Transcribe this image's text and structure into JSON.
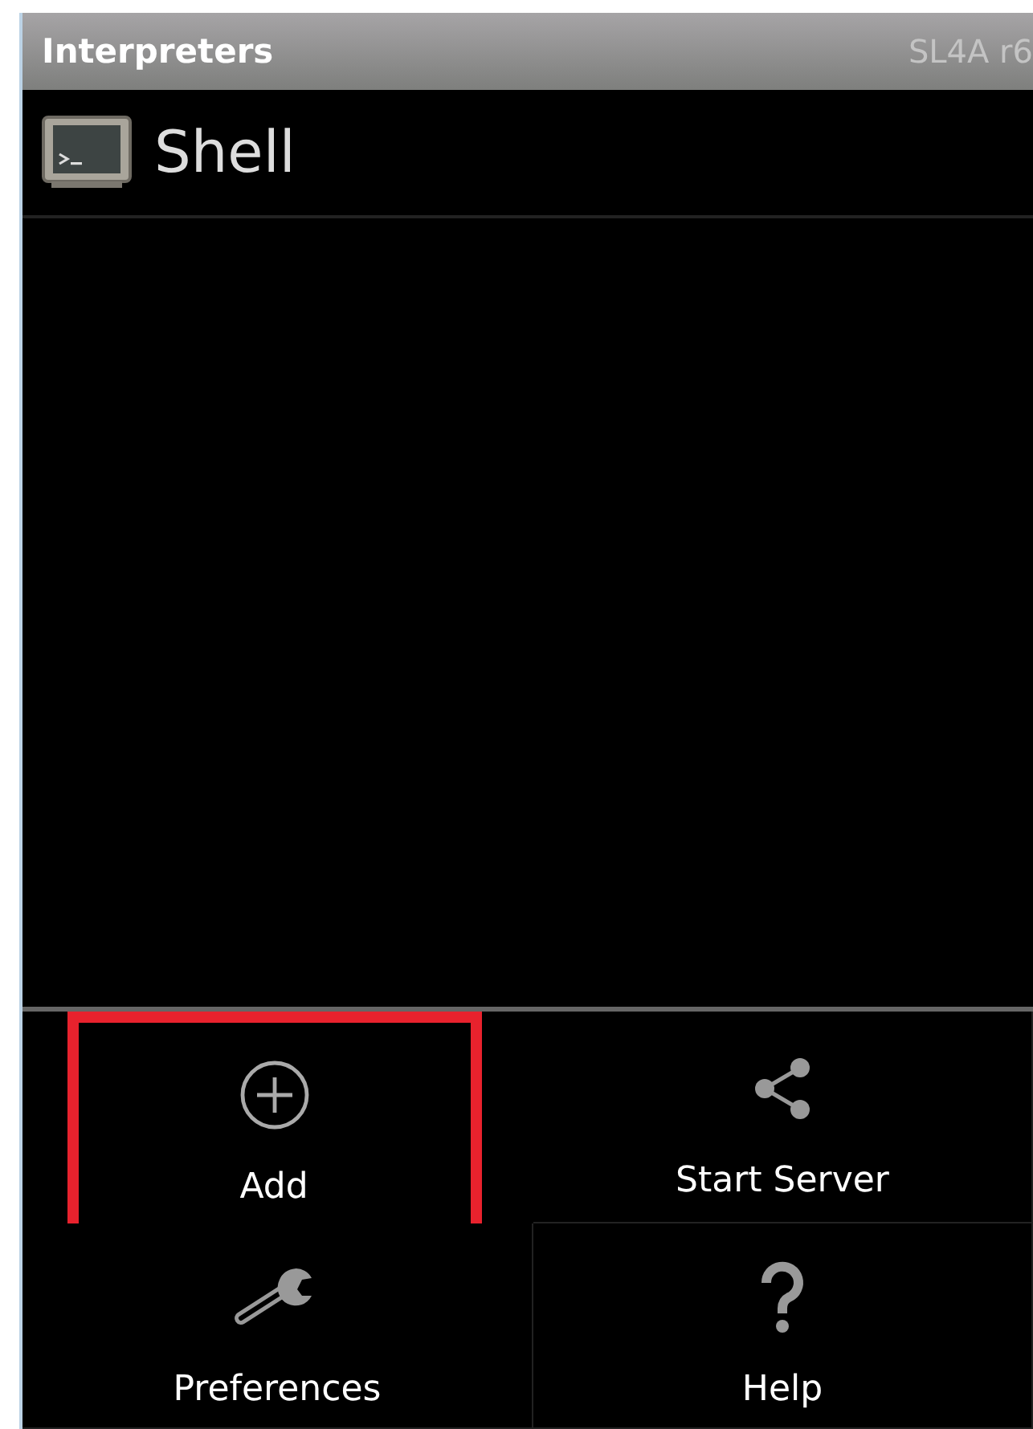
{
  "action_bar": {
    "title": "Interpreters",
    "version": "SL4A r6"
  },
  "interpreters": [
    {
      "name": "Shell",
      "kind": "shell"
    }
  ],
  "menu": [
    {
      "label": "Add",
      "kind": "add",
      "highlighted": true
    },
    {
      "label": "Start Server",
      "kind": "share",
      "highlighted": false
    },
    {
      "label": "Preferences",
      "kind": "wrench",
      "highlighted": false
    },
    {
      "label": "Help",
      "kind": "help",
      "highlighted": false
    }
  ]
}
